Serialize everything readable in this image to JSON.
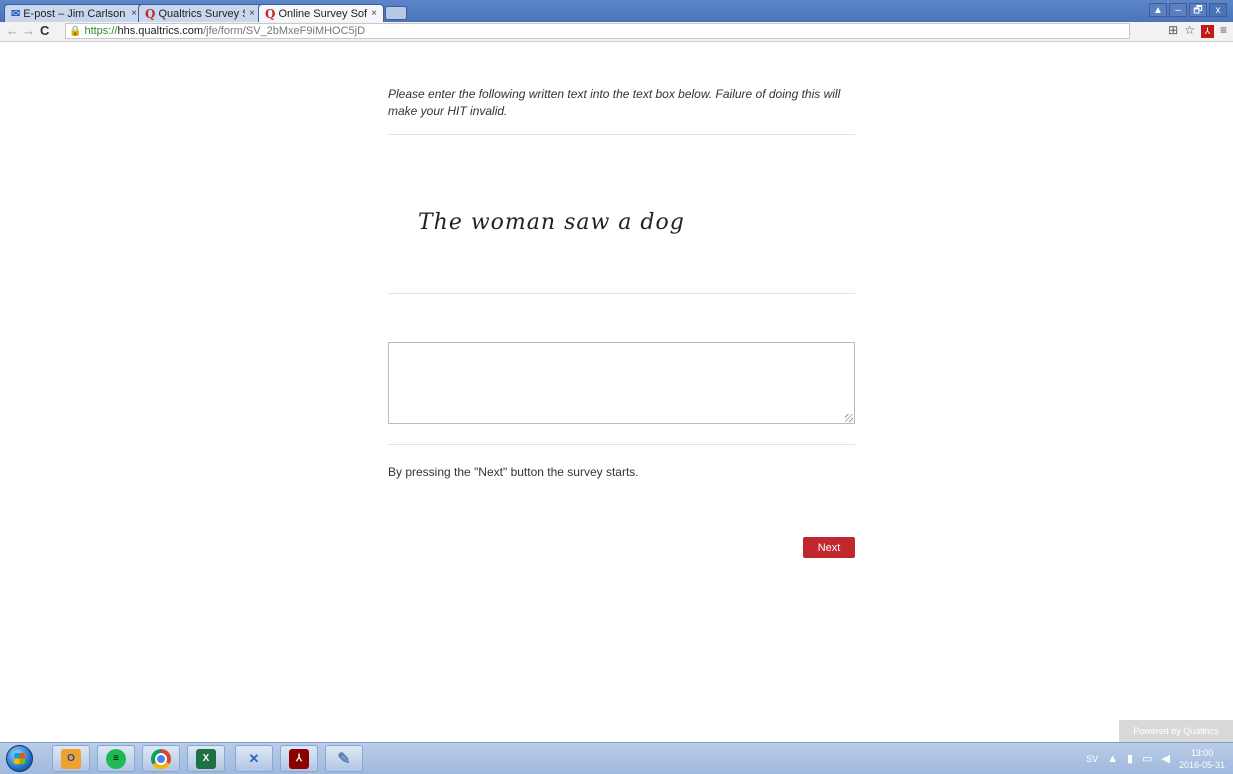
{
  "browser": {
    "tabs": [
      {
        "title": "E-post – Jim Carlson",
        "icon": "mail-icon",
        "active": false
      },
      {
        "title": "Qualtrics Survey Soft",
        "icon": "qualtrics-icon",
        "active": false
      },
      {
        "title": "Online Survey Softw",
        "icon": "qualtrics-icon",
        "active": true
      }
    ],
    "tab_close": "×",
    "window_controls": {
      "user": "▲",
      "minimize": "–",
      "restore": "🗗",
      "close": "x"
    },
    "address": {
      "scheme": "https://",
      "host": "hhs.qualtrics.com",
      "path": "/jfe/form/SV_2bMxeF9iMHOC5jD"
    },
    "nav": {
      "back": "←",
      "forward": "→",
      "reload": "C"
    },
    "toolbar_icons": {
      "translate": "⊞",
      "star": "☆",
      "menu": "≡"
    }
  },
  "survey": {
    "instruction": "Please enter the following written text into the text box below. Failure of doing this will make your HIT invalid.",
    "handwritten_text": "The woman saw a dog",
    "answer_value": "",
    "start_note": "By pressing the \"Next\" button the survey starts.",
    "next_label": "Next",
    "powered_by": "Powered by Qualtrics"
  },
  "colors": {
    "next_button": "#c1272d",
    "tab_strip": "#4a73b8"
  },
  "taskbar": {
    "apps": [
      "outlook-icon",
      "spotify-icon",
      "chrome-icon",
      "excel-icon",
      "rx-icon",
      "acrobat-icon",
      "paint-icon"
    ],
    "tray": {
      "language": "SV",
      "time": "13:00",
      "date": "2016-05-31"
    }
  }
}
